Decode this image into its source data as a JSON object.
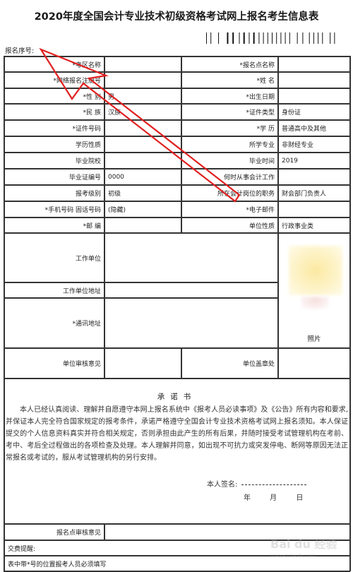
{
  "document": {
    "title": "2020年度全国会计专业技术初级资格考试网上报名考生信息表",
    "serial_label": "报名序号:",
    "barcode_icon": "barcode-icon"
  },
  "form": {
    "rows": [
      {
        "l1": "*考区名称",
        "v1": "",
        "l2": "*报名点名称",
        "v2": ""
      },
      {
        "l1": "*网络报名注册号",
        "v1": "",
        "l2": "*姓 名",
        "v2": ""
      },
      {
        "l1": "*性 别",
        "v1": "男",
        "l2": "*出生日期",
        "v2": ""
      },
      {
        "l1": "*民 族",
        "v1": "汉族",
        "l2": "*证件类型",
        "v2": "身份证"
      },
      {
        "l1": "*证件号码",
        "v1": "",
        "l2": "*学 历",
        "v2": "普通高中及其他"
      },
      {
        "l1": "学历性质",
        "v1": "",
        "l2": "所学专业",
        "v2": "非财经专业"
      },
      {
        "l1": "毕业院校",
        "v1": "",
        "l2": "毕业时间",
        "v2": "2019"
      },
      {
        "l1": "毕业证编号",
        "v1": "0000",
        "l2": "何时从事会计工作",
        "v2": ""
      },
      {
        "l1": "报考级别",
        "v1": "初级",
        "l2": "所在会计岗位的职务",
        "v2": "财会部门负责人"
      },
      {
        "l1": "*手机号码 固话号码",
        "v1": "(隐藏)",
        "l2": "*电子邮件",
        "v2": ""
      },
      {
        "l1": "*邮 编",
        "v1": "",
        "l2": "单位性质",
        "v2": "行政事业类"
      }
    ],
    "work_unit_label": "工作单位",
    "work_unit_value": "",
    "work_address_label": "工作单位地址",
    "work_address_value": "",
    "mail_address_label": "*通讯地址",
    "mail_address_value": "",
    "photo_label": "照片",
    "unit_review_label": "单位审核意见",
    "unit_seal_label": "单位盖章处",
    "pledge": {
      "title": "承诺书",
      "body": "本人已经认真阅读、理解并自愿遵守本网上报名系统中《报考人员必读事项》及《公告》所有内容和要求,并保证本人完全符合国家规定的报考条件，承诺严格遵守全国会计专业技术资格考试网上报名须知。本人保证提交的个人信息资料真实并符合相关规定，否则承担由此产生的所有后果，并随时接受考试管理机构在考前、考中、考后全过程做出的各项检查及处理。本人理解并同意，如出现不可抗力或突发停电、断网等原因无法正常报名或考试的，服从考试管理机构的另行安排。",
      "signature_label": "本人签名:",
      "date_text": "年 月 日"
    },
    "site_review_label": "报名点审核意见",
    "fee_reminder": "交费提醒:",
    "footnote": "表中带*号的位置报考人员必须填写"
  },
  "watermark": {
    "brand": "Bai du 经验",
    "url": "jingyan.baidu.com"
  },
  "annotation": {
    "type": "red-arrow",
    "color": "#e02020",
    "points_to": "报名序号"
  }
}
